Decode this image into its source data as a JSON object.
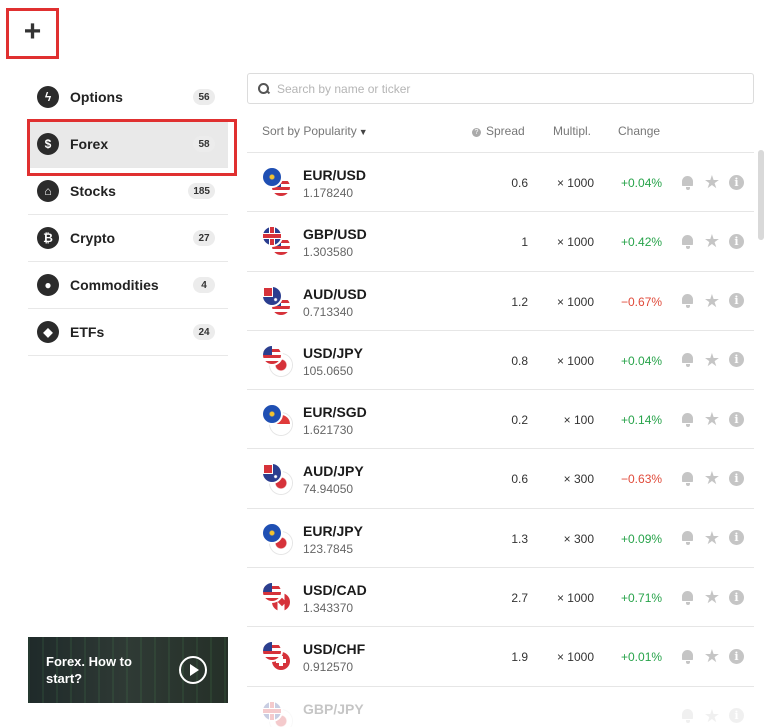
{
  "add_button": {
    "label": "+"
  },
  "sidebar": {
    "items": [
      {
        "label": "Options",
        "count": "56",
        "icon": "lightning-icon",
        "glyph": "ϟ",
        "active": false
      },
      {
        "label": "Forex",
        "count": "58",
        "icon": "dollar-icon",
        "glyph": "$",
        "active": true
      },
      {
        "label": "Stocks",
        "count": "185",
        "icon": "bank-icon",
        "glyph": "⌂",
        "active": false
      },
      {
        "label": "Crypto",
        "count": "27",
        "icon": "bitcoin-icon",
        "glyph": "₿",
        "active": false
      },
      {
        "label": "Commodities",
        "count": "4",
        "icon": "drop-icon",
        "glyph": "●",
        "active": false
      },
      {
        "label": "ETFs",
        "count": "24",
        "icon": "cube-icon",
        "glyph": "◆",
        "active": false
      }
    ]
  },
  "promo": {
    "text": "Forex. How to start?"
  },
  "search": {
    "placeholder": "Search by name or ticker",
    "value": ""
  },
  "table": {
    "sort_label": "Sort by Popularity",
    "headers": {
      "spread": "Spread",
      "multiplier": "Multipl.",
      "change": "Change"
    },
    "rows": [
      {
        "pair": "EUR/USD",
        "price": "1.178240",
        "spread": "0.6",
        "mult": "× 1000",
        "change": "+0.04%",
        "dir": "pos",
        "f1": "eu",
        "f2": "us"
      },
      {
        "pair": "GBP/USD",
        "price": "1.303580",
        "spread": "1",
        "mult": "× 1000",
        "change": "+0.42%",
        "dir": "pos",
        "f1": "gb",
        "f2": "us"
      },
      {
        "pair": "AUD/USD",
        "price": "0.713340",
        "spread": "1.2",
        "mult": "× 1000",
        "change": "−0.67%",
        "dir": "neg",
        "f1": "au",
        "f2": "us"
      },
      {
        "pair": "USD/JPY",
        "price": "105.0650",
        "spread": "0.8",
        "mult": "× 1000",
        "change": "+0.04%",
        "dir": "pos",
        "f1": "us",
        "f2": "jp"
      },
      {
        "pair": "EUR/SGD",
        "price": "1.621730",
        "spread": "0.2",
        "mult": "× 100",
        "change": "+0.14%",
        "dir": "pos",
        "f1": "eu",
        "f2": "sg"
      },
      {
        "pair": "AUD/JPY",
        "price": "74.94050",
        "spread": "0.6",
        "mult": "× 300",
        "change": "−0.63%",
        "dir": "neg",
        "f1": "au",
        "f2": "jp"
      },
      {
        "pair": "EUR/JPY",
        "price": "123.7845",
        "spread": "1.3",
        "mult": "× 300",
        "change": "+0.09%",
        "dir": "pos",
        "f1": "eu",
        "f2": "jp"
      },
      {
        "pair": "USD/CAD",
        "price": "1.343370",
        "spread": "2.7",
        "mult": "× 1000",
        "change": "+0.71%",
        "dir": "pos",
        "f1": "us",
        "f2": "ca"
      },
      {
        "pair": "USD/CHF",
        "price": "0.912570",
        "spread": "1.9",
        "mult": "× 1000",
        "change": "+0.01%",
        "dir": "pos",
        "f1": "us",
        "f2": "ch"
      },
      {
        "pair": "GBP/JPY",
        "price": "",
        "spread": "",
        "mult": "",
        "change": "",
        "dir": "pos",
        "f1": "gb",
        "f2": "jp",
        "faded": true
      }
    ]
  },
  "colors": {
    "accent_red": "#e03030",
    "positive": "#27a34a",
    "negative": "#e04a3a"
  }
}
